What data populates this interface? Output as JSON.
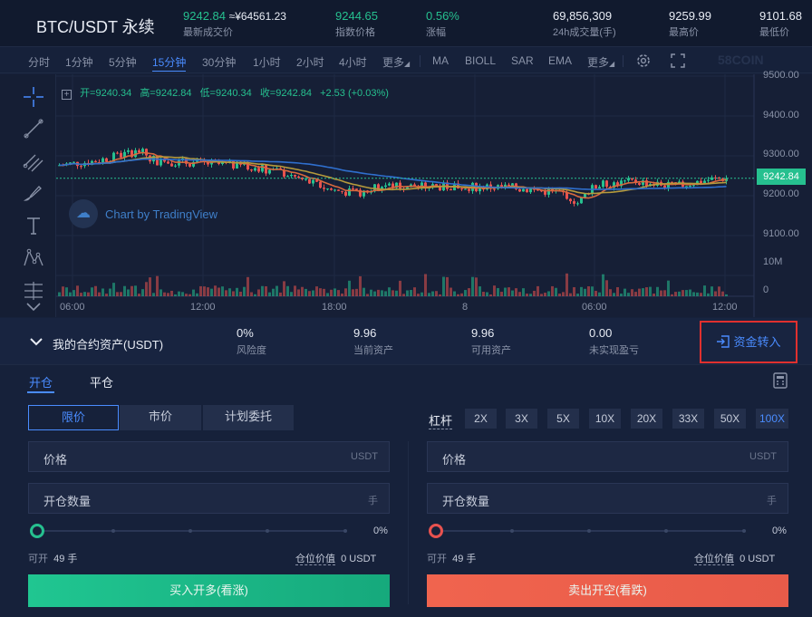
{
  "header": {
    "symbol": "BTC/USDT 永续",
    "last_price": "9242.84",
    "last_price_cny": "≈¥64561.23",
    "last_price_label": "最新成交价",
    "index_price": "9244.65",
    "index_price_label": "指数价格",
    "change": "0.56%",
    "change_label": "涨幅",
    "volume": "69,856,309",
    "volume_label": "24h成交量(手)",
    "high": "9259.99",
    "high_label": "最高价",
    "low": "9101.68",
    "low_label": "最低价"
  },
  "toolbar": {
    "intervals": [
      "分时",
      "1分钟",
      "5分钟",
      "15分钟",
      "30分钟",
      "1小时",
      "2小时",
      "4小时",
      "更多"
    ],
    "active_interval": "15分钟",
    "indicators": [
      "MA",
      "BIOLL",
      "SAR",
      "EMA",
      "更多"
    ],
    "brand": "58COIN"
  },
  "chart": {
    "ohlc": {
      "open": "开=9240.34",
      "high": "高=9242.84",
      "low": "低=9240.34",
      "close": "收=9242.84",
      "change": "+2.53 (+0.03%)"
    },
    "watermark": "Chart by TradingView",
    "last_price_tag": "9242.84",
    "price_ticks": [
      "9500.00",
      "9400.00",
      "9300.00",
      "9200.00",
      "9100.00"
    ],
    "volume_ticks": [
      "10M",
      "0"
    ],
    "time_ticks": [
      "06:00",
      "12:00",
      "18:00",
      "8",
      "06:00",
      "12:00"
    ]
  },
  "chart_data": {
    "type": "candlestick",
    "ylim": [
      9090,
      9500
    ],
    "last_price": 9242.84,
    "ma_lines": [
      "MA-short",
      "MA-mid",
      "MA-long"
    ],
    "colors": {
      "up": "#26c08f",
      "down": "#e8524f",
      "ma_short": "#d9693d",
      "ma_mid": "#b59a3c",
      "ma_long": "#2f6fce"
    }
  },
  "assets": {
    "title": "我的合约资产(USDT)",
    "risk": "0%",
    "risk_label": "风险度",
    "current": "9.96",
    "current_label": "当前资产",
    "available": "9.96",
    "available_label": "可用资产",
    "unrealized": "0.00",
    "unrealized_label": "未实现盈亏",
    "transfer_label": "资金转入"
  },
  "order": {
    "tab_open": "开仓",
    "tab_close": "平仓",
    "types": [
      "限价",
      "市价",
      "计划委托"
    ],
    "leverage_label": "杠杆",
    "leverages": [
      "2X",
      "3X",
      "5X",
      "10X",
      "20X",
      "33X",
      "50X",
      "100X"
    ],
    "active_leverage": "100X",
    "price_label": "价格",
    "price_unit": "USDT",
    "qty_label": "开仓数量",
    "qty_unit": "手",
    "percent": "0%",
    "avail_label": "可开",
    "avail_value": "49 手",
    "margin_label": "仓位价值",
    "margin_value": "0 USDT",
    "buy_label": "买入开多(看涨)",
    "sell_label": "卖出开空(看跌)",
    "slider_fraction": 0
  }
}
